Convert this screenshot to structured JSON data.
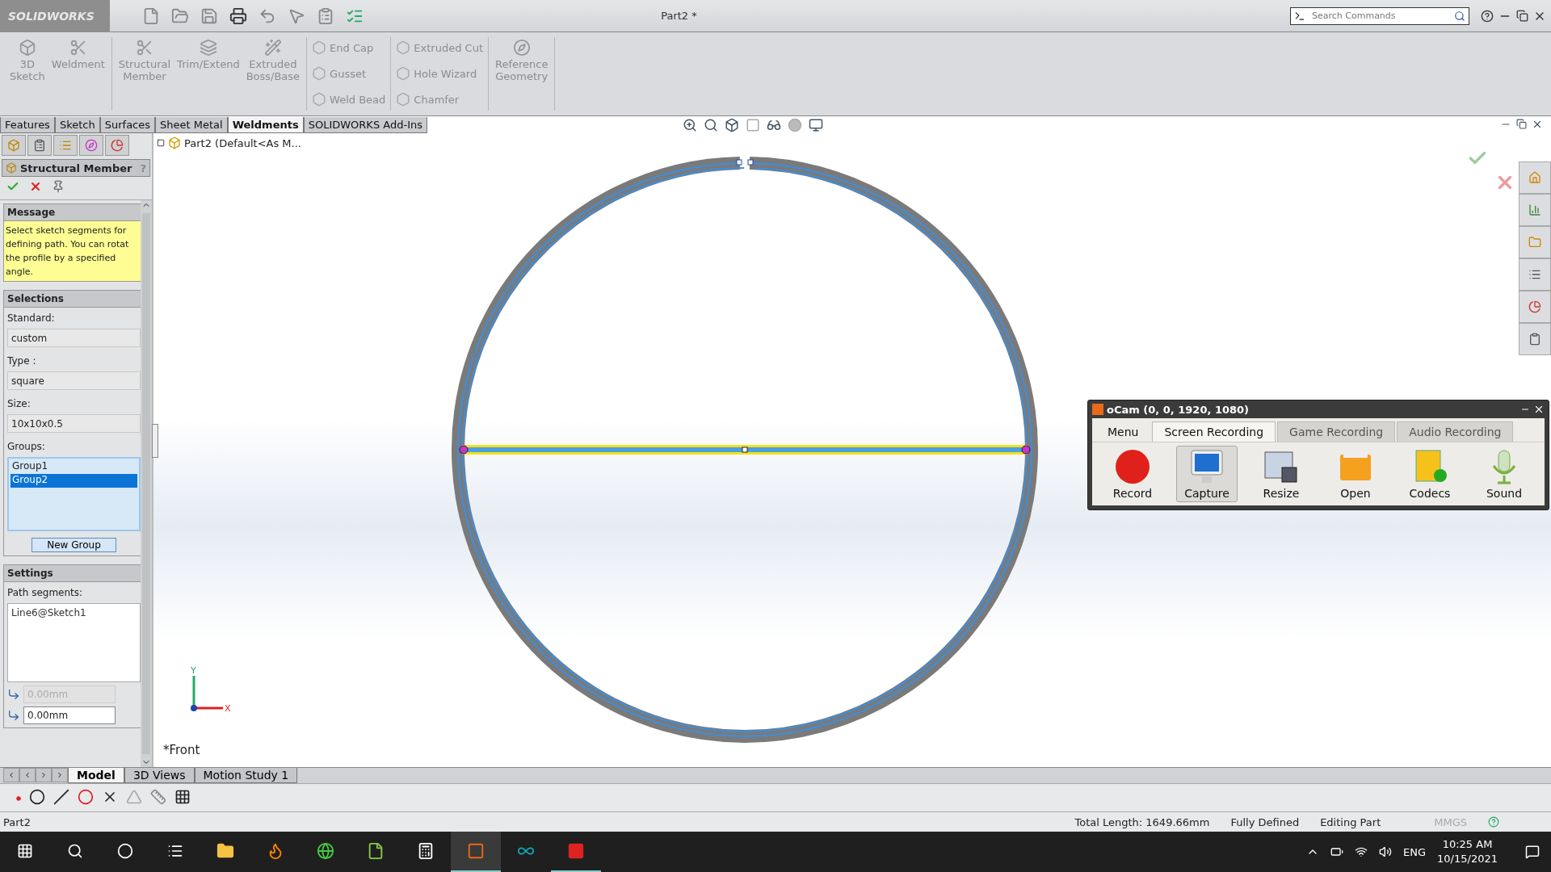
{
  "app": {
    "logo": "SOLIDWORKS",
    "title": "Part2 *",
    "search": {
      "placeholder": "Search Commands"
    }
  },
  "ribbon": [
    {
      "kind": "large",
      "items": [
        {
          "label": "3D\nSketch"
        },
        {
          "label": "Weldment"
        }
      ]
    },
    {
      "kind": "large",
      "items": [
        {
          "label": "Structural\nMember"
        },
        {
          "label": "Trim/Extend"
        },
        {
          "label": "Extruded\nBoss/Base"
        }
      ]
    },
    {
      "kind": "small",
      "items": [
        {
          "label": "End Cap"
        },
        {
          "label": "Gusset"
        },
        {
          "label": "Weld Bead"
        }
      ]
    },
    {
      "kind": "small",
      "items": [
        {
          "label": "Extruded Cut"
        },
        {
          "label": "Hole Wizard"
        },
        {
          "label": "Chamfer"
        }
      ]
    },
    {
      "kind": "large",
      "items": [
        {
          "label": "Reference\nGeometry"
        }
      ]
    }
  ],
  "command_tabs": [
    {
      "label": "Features",
      "selected": false
    },
    {
      "label": "Sketch",
      "selected": false
    },
    {
      "label": "Surfaces",
      "selected": false
    },
    {
      "label": "Sheet Metal",
      "selected": false
    },
    {
      "label": "Weldments",
      "selected": true
    },
    {
      "label": "SOLIDWORKS Add-Ins",
      "selected": false
    }
  ],
  "panel": {
    "title": "Structural Member",
    "help": "?",
    "message": {
      "heading": "Message",
      "text": "Select sketch segments for\ndefining path. You can rotat\nthe profile by a specified\nangle."
    },
    "selections": {
      "heading": "Selections",
      "fields": [
        {
          "label": "Standard:",
          "value": "custom"
        },
        {
          "label": "Type :",
          "value": "square"
        },
        {
          "label": "Size:",
          "value": "10x10x0.5"
        }
      ],
      "groups_label": "Groups:",
      "groups": [
        {
          "label": "Group1",
          "selected": false
        },
        {
          "label": "Group2",
          "selected": true
        }
      ],
      "button": "New Group"
    },
    "settings": {
      "heading": "Settings",
      "path_label": "Path segments:",
      "path_items": [
        "Line6@Sketch1"
      ],
      "offsets": [
        {
          "value": "0.00mm",
          "disabled": true
        },
        {
          "value": "0.00mm",
          "disabled": false
        }
      ]
    }
  },
  "tree": {
    "label": "Part2  (Default<As M..."
  },
  "view": {
    "label": "*Front",
    "axes": [
      "Y",
      "X"
    ]
  },
  "ocam": {
    "title": "oCam (0, 0, 1920, 1080)",
    "tabs": [
      {
        "label": "Menu",
        "kind": "menu",
        "selected": false
      },
      {
        "label": "Screen Recording",
        "kind": "tab",
        "selected": true
      },
      {
        "label": "Game Recording",
        "kind": "tab",
        "selected": false
      },
      {
        "label": "Audio Recording",
        "kind": "tab",
        "selected": false
      }
    ],
    "tools": [
      {
        "label": "Record",
        "kind": "record",
        "selected": false
      },
      {
        "label": "Capture",
        "kind": "capture",
        "selected": true
      },
      {
        "label": "Resize",
        "kind": "resize",
        "selected": false
      },
      {
        "label": "Open",
        "kind": "open",
        "selected": false
      },
      {
        "label": "Codecs",
        "kind": "codecs",
        "selected": false
      },
      {
        "label": "Sound",
        "kind": "sound",
        "selected": false
      }
    ]
  },
  "bottom_tabs": [
    {
      "label": "Model",
      "selected": true
    },
    {
      "label": "3D Views",
      "selected": false
    },
    {
      "label": "Motion Study 1",
      "selected": false
    }
  ],
  "status": {
    "left": "Part2",
    "right": [
      "Total Length: 1649.66mm",
      "Fully Defined",
      "Editing Part"
    ],
    "units": "MMGS"
  },
  "taskbar": {
    "language": "ENG",
    "time": "10:25 AM",
    "date": "10/15/2021"
  }
}
